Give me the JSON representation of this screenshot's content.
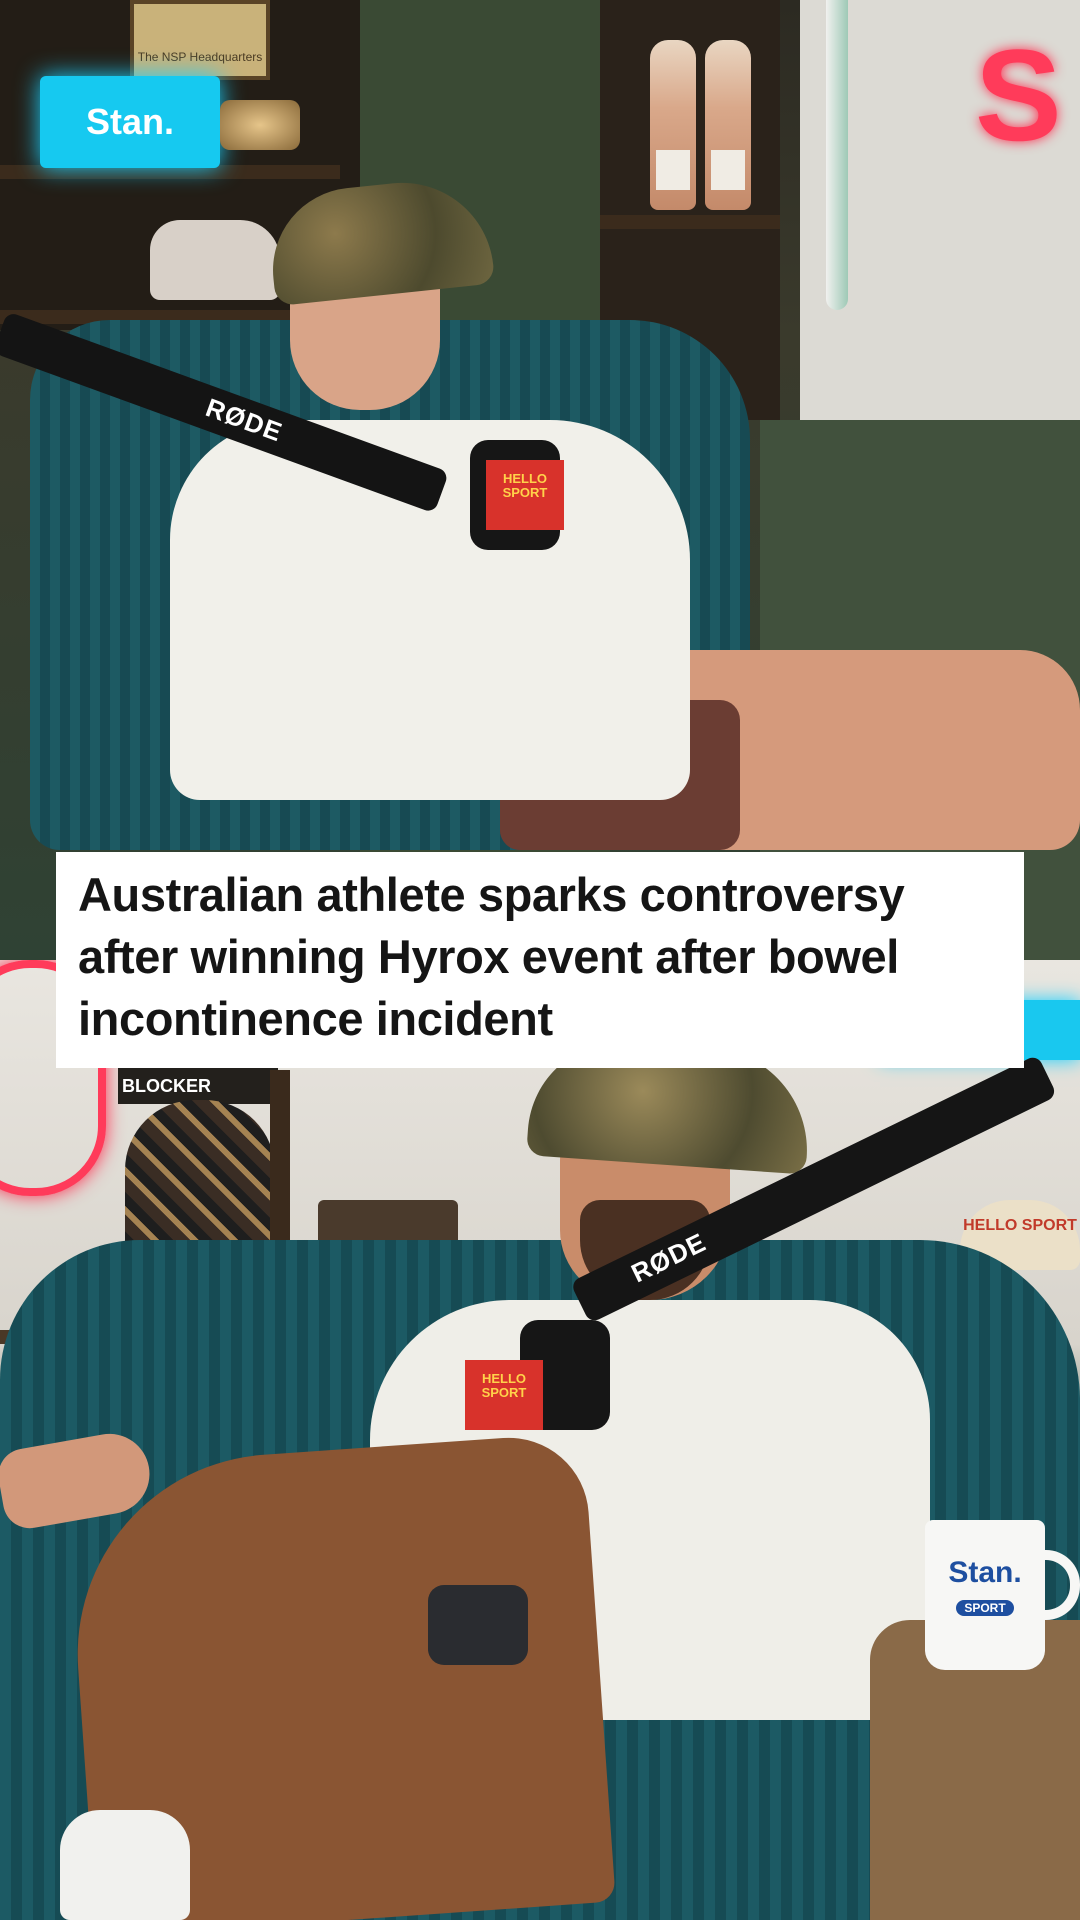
{
  "caption": {
    "text": "Australian athlete sparks controversy after winning Hyrox event after bowel incontinence incident",
    "lines": [
      "Australian athlete sparks controversy",
      "after winning Hyrox event after bowel",
      "incontinence incident"
    ]
  },
  "scene_text": {
    "plaque": "The NSP Headquarters",
    "stan_sign": "Stan.",
    "boom_brand": "RØDE",
    "mic_flag": "HELLO SPORT",
    "blocker": "BLOCKER",
    "cap_shelf": "HELLO SPORT",
    "mug": "Stan.",
    "mug_sub": "SPORT"
  },
  "colors": {
    "caption_bg": "#ffffff",
    "caption_text": "#151515",
    "neon_red": "#ff3b5a",
    "stan_blue": "#16c9f0",
    "chair_teal": "#1d5a63"
  }
}
